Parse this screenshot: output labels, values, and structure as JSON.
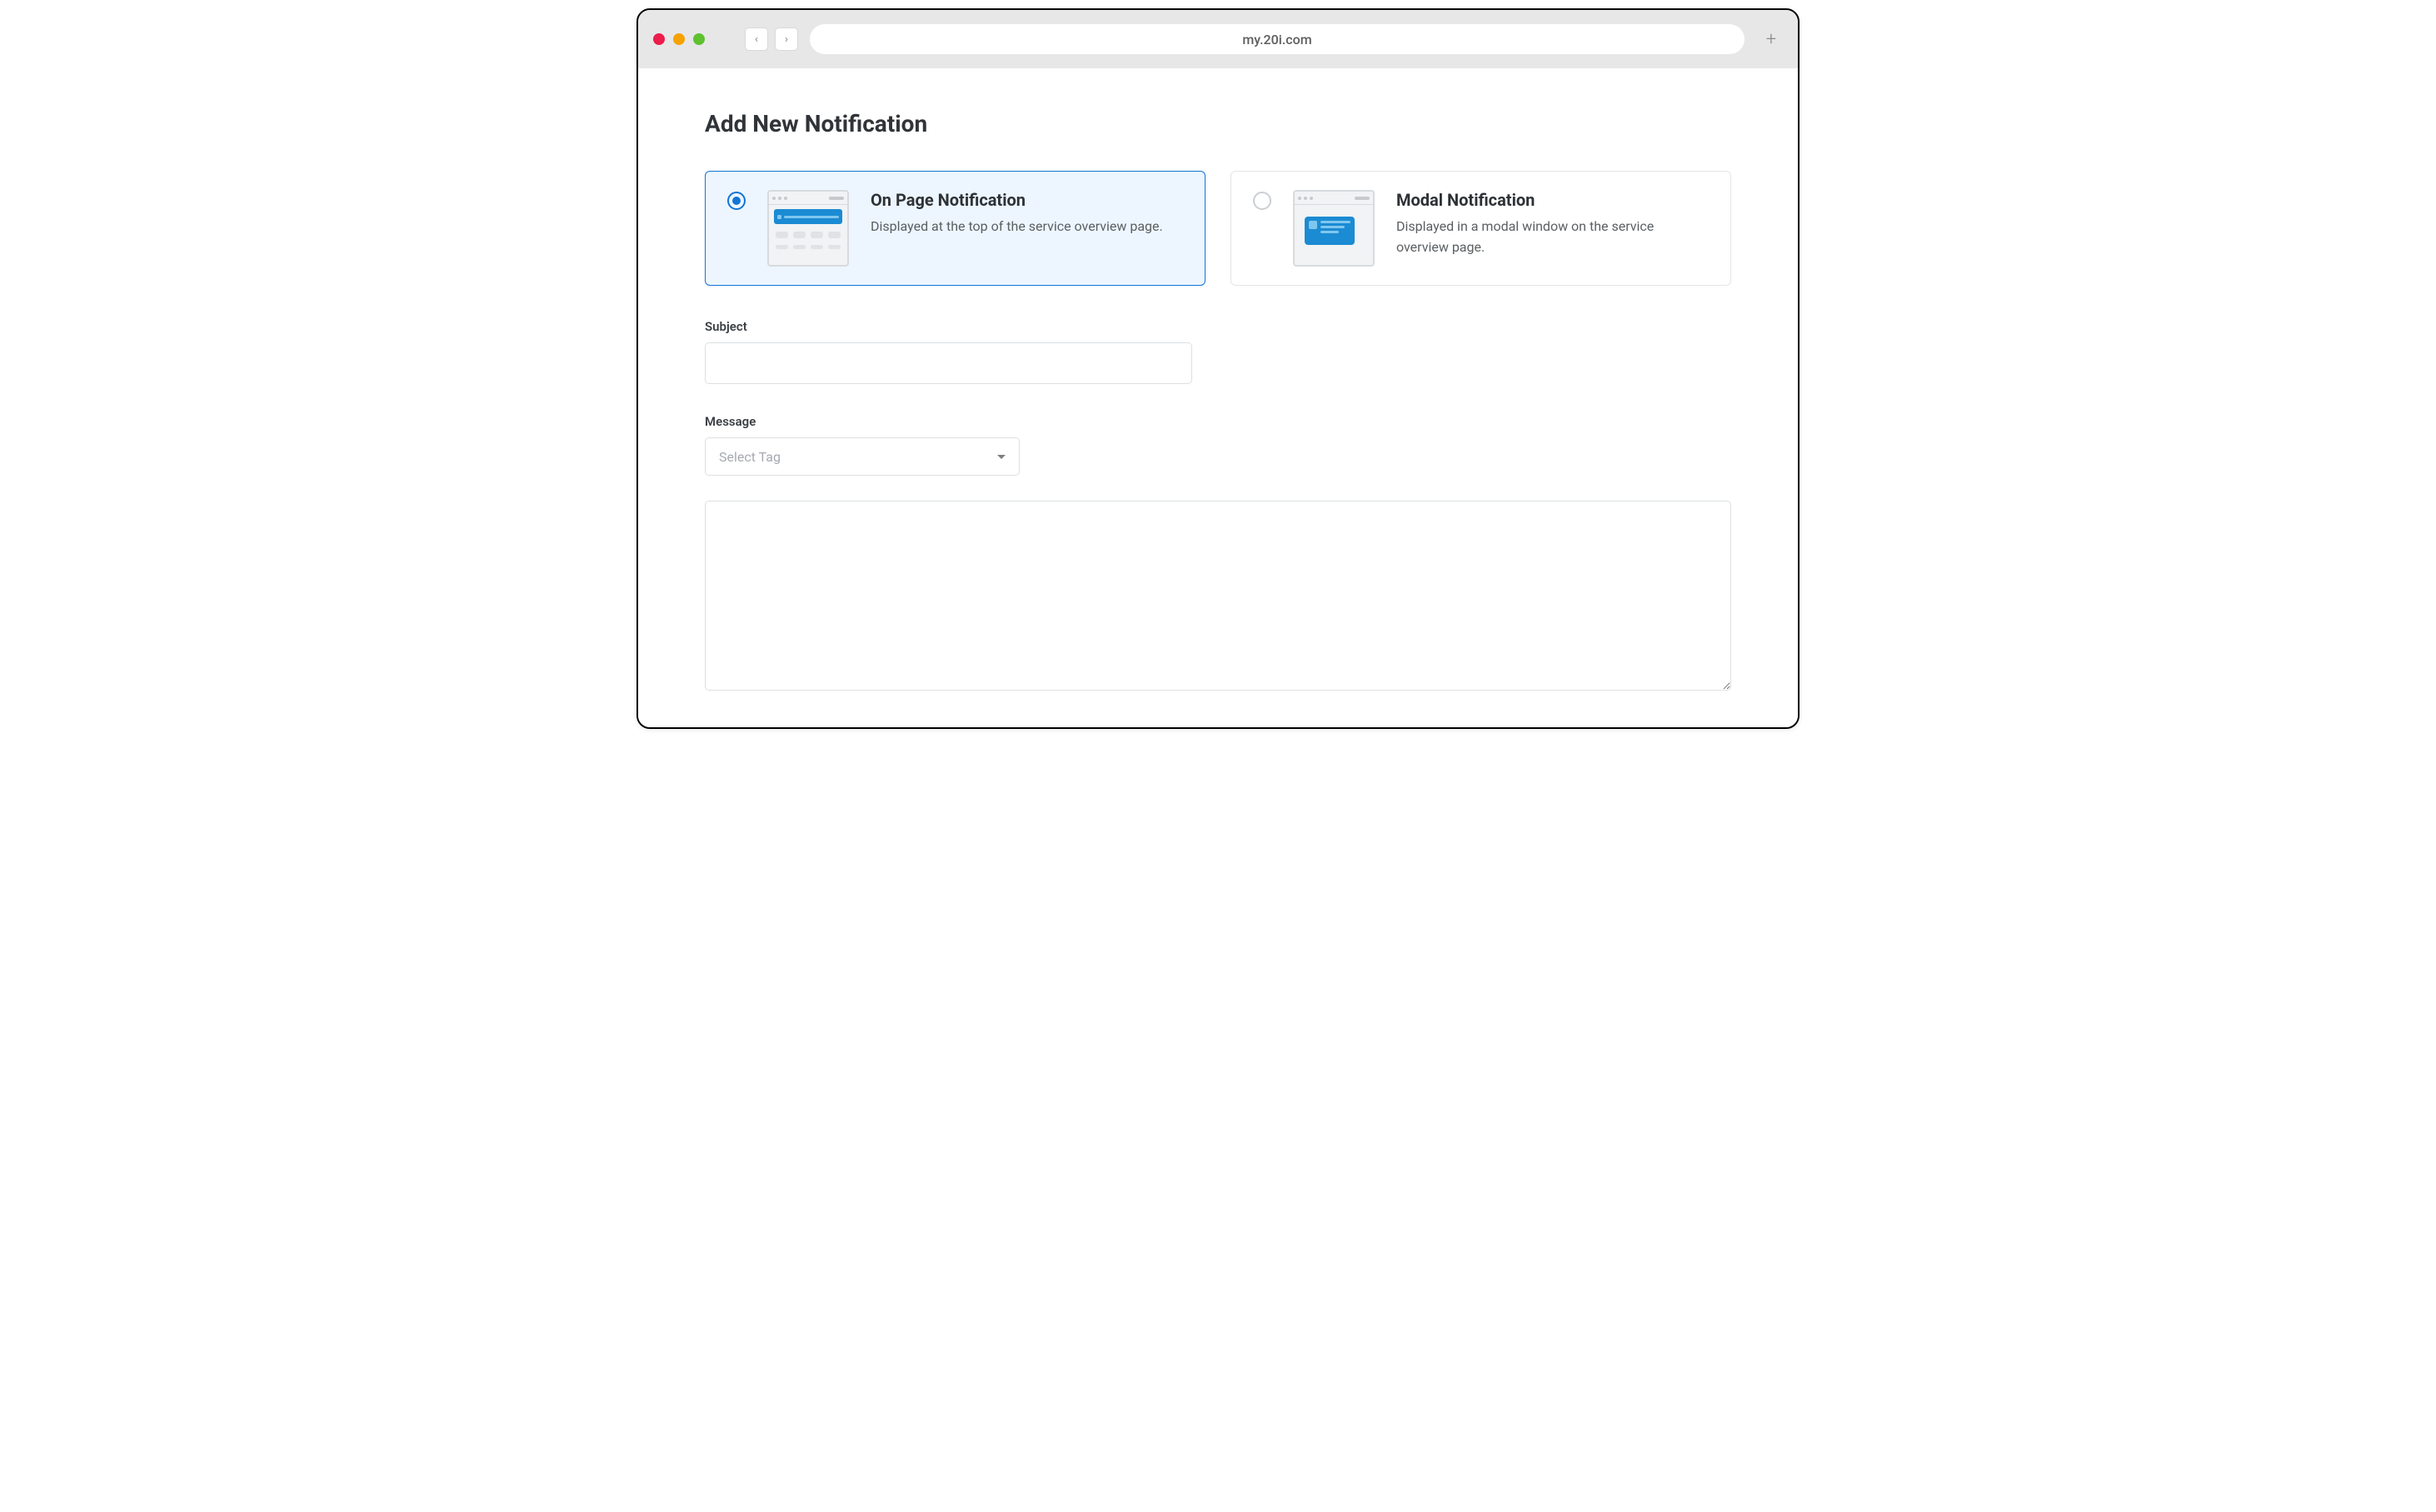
{
  "browser": {
    "url": "my.20i.com"
  },
  "page": {
    "title": "Add New Notification"
  },
  "options": {
    "on_page": {
      "title": "On Page Notification",
      "desc": "Displayed at the top of the service overview page."
    },
    "modal": {
      "title": "Modal Notification",
      "desc": "Displayed in a modal window on the service overview page."
    }
  },
  "form": {
    "subject_label": "Subject",
    "subject_value": "",
    "message_label": "Message",
    "tag_placeholder": "Select Tag",
    "message_value": ""
  }
}
